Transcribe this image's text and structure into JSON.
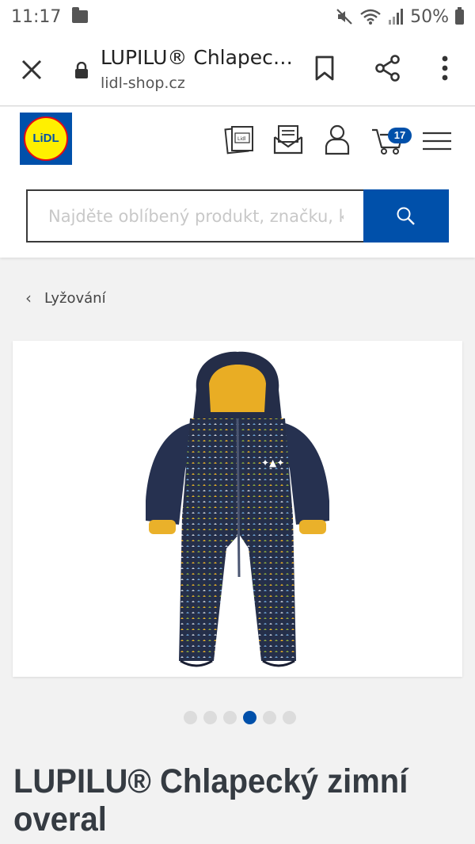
{
  "status_bar": {
    "time": "11:17",
    "battery": "50%"
  },
  "browser": {
    "title": "LUPILU® Chlapec…",
    "domain": "lidl-shop.cz"
  },
  "header": {
    "logo_text": "LiDL",
    "cart_count": "17",
    "search_placeholder": "Najděte oblíbený produkt, značku, kat"
  },
  "breadcrumb": {
    "label": "Lyžování"
  },
  "carousel": {
    "total": 6,
    "active_index": 3
  },
  "product": {
    "title": "LUPILU® Chlapecký zimní overal"
  },
  "colors": {
    "lidl_blue": "#0050aa",
    "lidl_yellow": "#fff000",
    "lidl_red": "#e60a14",
    "overall_navy": "#252f4a",
    "overall_yellow": "#f0b323"
  }
}
